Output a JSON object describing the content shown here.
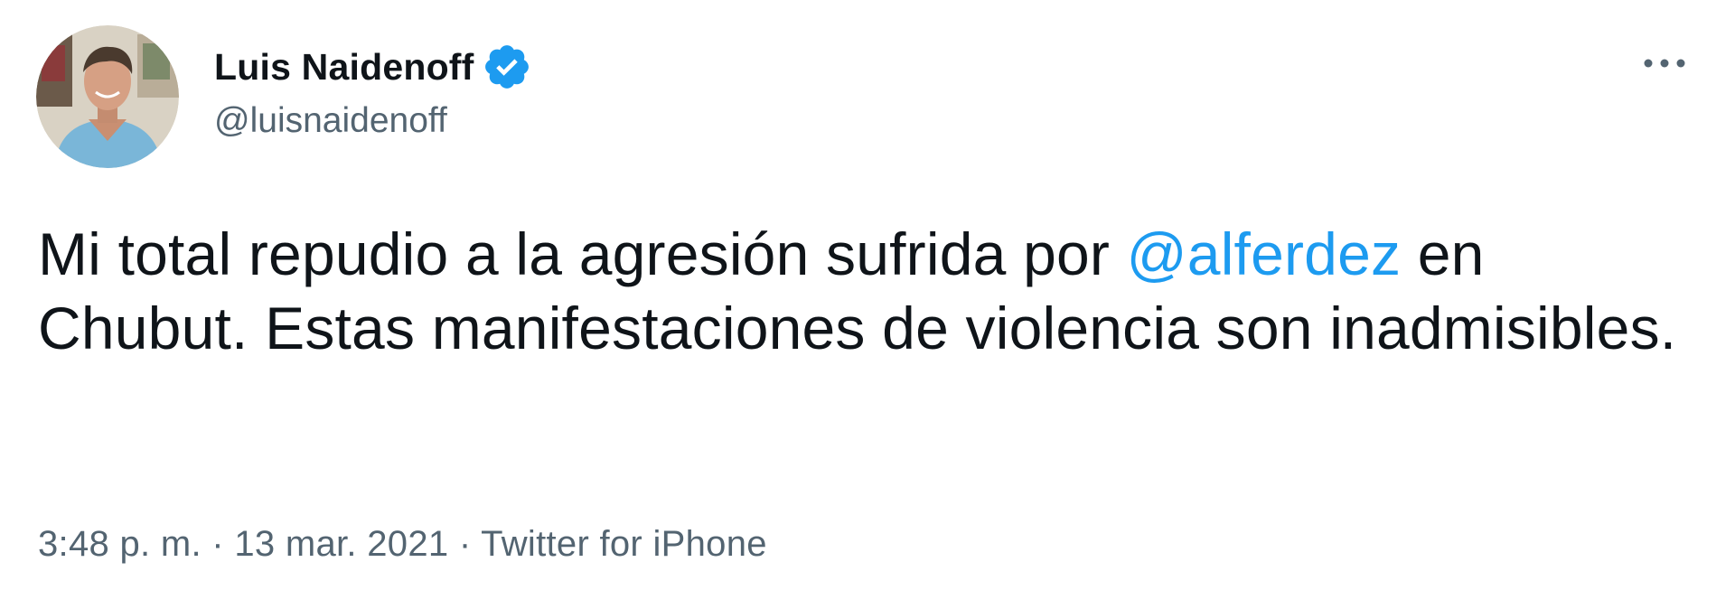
{
  "author": {
    "display_name": "Luis Naidenoff",
    "handle": "@luisnaidenoff",
    "verified_icon": "verified-badge-icon"
  },
  "tweet": {
    "text_before_mention": "Mi total repudio a la agresión sufrida por ",
    "mention": "@alferdez",
    "text_after_mention": " en Chubut. Estas manifestaciones de violencia son inadmisibles."
  },
  "meta": {
    "time": "3:48 p. m.",
    "separator_1": " · ",
    "date": "13 mar. 2021",
    "separator_2": " · ",
    "source": "Twitter for iPhone"
  },
  "icons": {
    "more": "more-options-icon"
  },
  "colors": {
    "accent": "#1d9bf0",
    "text_primary": "#0f1419",
    "text_secondary": "#536471"
  }
}
